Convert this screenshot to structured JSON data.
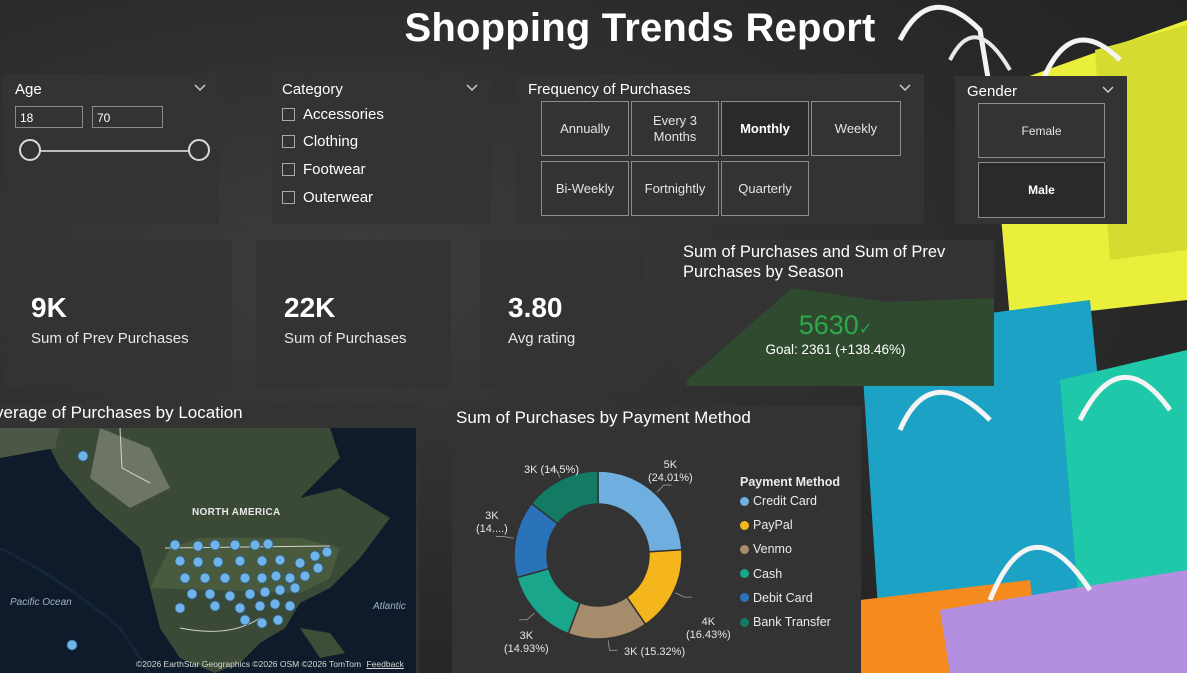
{
  "report": {
    "title": "Shopping Trends Report"
  },
  "age_slicer": {
    "label": "Age",
    "min_value": "18",
    "max_value": "70"
  },
  "category_slicer": {
    "label": "Category",
    "items": [
      "Accessories",
      "Clothing",
      "Footwear",
      "Outerwear"
    ]
  },
  "frequency_slicer": {
    "label": "Frequency of Purchases",
    "options": [
      "Annually",
      "Every 3 Months",
      "Monthly",
      "Weekly",
      "Bi-Weekly",
      "Fortnightly",
      "Quarterly"
    ],
    "selected": "Monthly"
  },
  "gender_slicer": {
    "label": "Gender",
    "options": [
      "Female",
      "Male"
    ],
    "selected": "Male"
  },
  "kpis": [
    {
      "value": "9K",
      "label": "Sum of Prev Purchases"
    },
    {
      "value": "22K",
      "label": "Sum of Purchases"
    },
    {
      "value": "3.80",
      "label": "Avg rating"
    }
  ],
  "season_kpi": {
    "title": "Sum of Purchases and Sum of Prev Purchases by Season",
    "value": "5630",
    "goal_text": "Goal: 2361 (+138.46%)",
    "color": "#2e8b3d"
  },
  "map": {
    "title": "Average of Purchases by Location",
    "labels": {
      "continent": "NORTH AMERICA",
      "ocean1": "Pacific Ocean",
      "ocean2": "Atlantic"
    },
    "attribution": "©2026 EarthStar Geographics  ©2026 OSM  ©2026 TomTom",
    "feedback": "Feedback"
  },
  "payment_chart": {
    "title": "Sum of Purchases by Payment Method",
    "legend_title": "Payment Method"
  },
  "chart_data": {
    "type": "pie",
    "title": "Sum of Purchases by Payment Method",
    "legend_title": "Payment Method",
    "legend_placement": "right",
    "donut": true,
    "slices": [
      {
        "name": "Credit Card",
        "percent": 24.01,
        "label": "5K",
        "pct_label": "(24.01%)",
        "color": "#6fafe0"
      },
      {
        "name": "PayPal",
        "percent": 16.43,
        "label": "4K",
        "pct_label": "(16.43%)",
        "color": "#f5b51d"
      },
      {
        "name": "Venmo",
        "percent": 15.32,
        "label": "3K",
        "pct_label": "(15.32%)",
        "color": "#a58c6a"
      },
      {
        "name": "Cash",
        "percent": 14.93,
        "label": "3K",
        "pct_label": "(14.93%)",
        "color": "#1aa68a"
      },
      {
        "name": "Debit Card",
        "percent": 14.81,
        "label": "3K",
        "pct_label": "(14....)",
        "color": "#2b73b9"
      },
      {
        "name": "Bank Transfer",
        "percent": 14.5,
        "label": "3K",
        "pct_label": "(14.5%)",
        "color": "#137a64"
      }
    ]
  }
}
